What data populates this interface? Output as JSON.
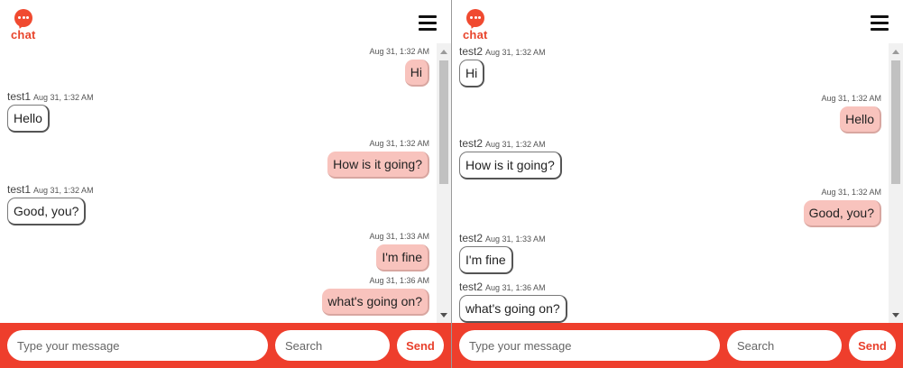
{
  "colors": {
    "accent": "#ee3e2c",
    "sent_bubble": "#f8c3bd",
    "logo": "#f04a30"
  },
  "panes": [
    {
      "logo_text": "chat",
      "messages": [
        {
          "dir": "sent",
          "name": "",
          "time": "Aug 31, 1:32 AM",
          "text": "Hi"
        },
        {
          "dir": "recv",
          "name": "test1",
          "time": "Aug 31, 1:32 AM",
          "text": "Hello"
        },
        {
          "dir": "sent",
          "name": "",
          "time": "Aug 31, 1:32 AM",
          "text": "How is it going?"
        },
        {
          "dir": "recv",
          "name": "test1",
          "time": "Aug 31, 1:32 AM",
          "text": "Good, you?"
        },
        {
          "dir": "sent",
          "name": "",
          "time": "Aug 31, 1:33 AM",
          "text": "I'm fine"
        },
        {
          "dir": "sent",
          "name": "",
          "time": "Aug 31, 1:36 AM",
          "text": "what's going on?"
        }
      ],
      "footer": {
        "message_placeholder": "Type your message",
        "search_placeholder": "Search",
        "send_label": "Send"
      }
    },
    {
      "logo_text": "chat",
      "messages": [
        {
          "dir": "recv",
          "name": "test2",
          "time": "Aug 31, 1:32 AM",
          "text": "Hi"
        },
        {
          "dir": "sent",
          "name": "",
          "time": "Aug 31, 1:32 AM",
          "text": "Hello"
        },
        {
          "dir": "recv",
          "name": "test2",
          "time": "Aug 31, 1:32 AM",
          "text": "How is it going?"
        },
        {
          "dir": "sent",
          "name": "",
          "time": "Aug 31, 1:32 AM",
          "text": "Good, you?"
        },
        {
          "dir": "recv",
          "name": "test2",
          "time": "Aug 31, 1:33 AM",
          "text": "I'm fine"
        },
        {
          "dir": "recv",
          "name": "test2",
          "time": "Aug 31, 1:36 AM",
          "text": "what's going on?"
        }
      ],
      "footer": {
        "message_placeholder": "Type your message",
        "search_placeholder": "Search",
        "send_label": "Send"
      }
    }
  ]
}
